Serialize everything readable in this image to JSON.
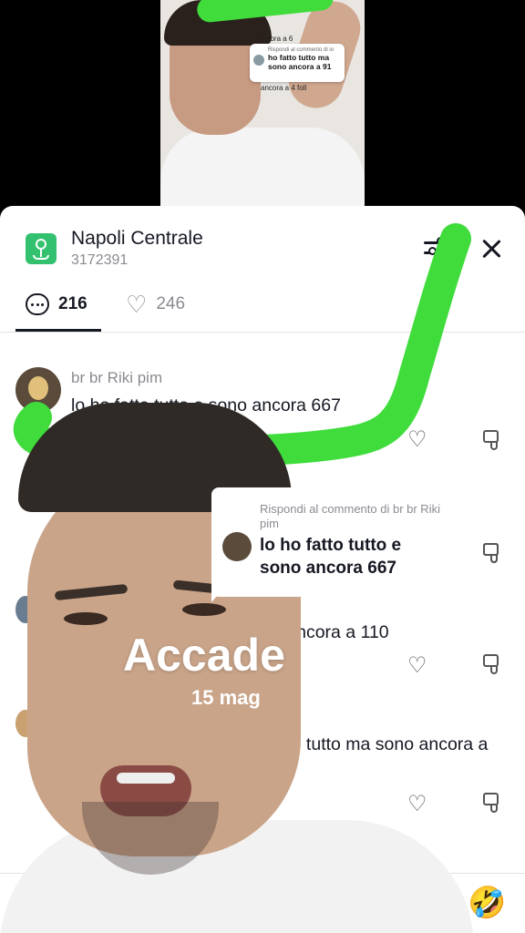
{
  "top_video": {
    "bubble_line1": "Rispondi al commento di io",
    "bubble_line2": "ho fatto tutto ma sono ancora a 91",
    "snippet1": "ncora a 6",
    "snippet2": "ancora a 4 foll"
  },
  "header": {
    "title": "Napoli Centrale",
    "subtitle": "3172391"
  },
  "tabs": {
    "comments_count": "216",
    "likes_count": "246"
  },
  "comments": [
    {
      "user": "br br Riki pim",
      "text": "lo ho fatto tutto e sono ancora 667"
    },
    {
      "user": "",
      "text": "o ancora a 110"
    },
    {
      "user": "",
      "text": "prio tutto ma sono ancora a"
    }
  ],
  "reply_bubble": {
    "title": "Rispondi al commento di br br Riki pim",
    "text": "lo ho fatto tutto e sono ancora 667"
  },
  "overlay": {
    "caption": "Accade",
    "date": "15 mag"
  },
  "colors": {
    "scribble": "#3fdc3c",
    "location_icon": "#34c16f",
    "text_primary": "#161823",
    "text_secondary": "#8a8b91"
  }
}
